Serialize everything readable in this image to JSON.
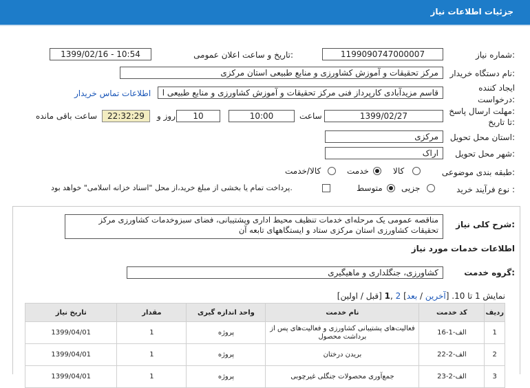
{
  "header": {
    "title": "جزئیات اطلاعات نیاز"
  },
  "form": {
    "need_number_label": "شماره نیاز:",
    "need_number": "1199090747000007",
    "announce_label": "تاریخ و ساعت اعلان عمومی:",
    "announce_value": "1399/02/16 - 10:54",
    "buyer_label": "نام دستگاه خریدار:",
    "buyer_value": "مرکز تحقیقات و آموزش کشاورزی و منابع طبیعی استان مرکزی",
    "requester_label_1": "ایجاد کننده",
    "requester_label_2": "درخواست:",
    "requester_value": "قاسم مزیدآبادی کارپرداز فنی مرکز تحقیقات و آموزش کشاورزی و منابع طبیعی ا",
    "contact_link": "اطلاعات تماس خریدار",
    "deadline_label_1": "مهلت ارسال پاسخ:",
    "deadline_label_2": "تا تاریخ:",
    "deadline_date": "1399/02/27",
    "time_label": "ساعت",
    "deadline_time": "10:00",
    "days_value": "10",
    "days_label": "روز و",
    "remaining_time": "22:32:29",
    "remaining_label": "ساعت باقی مانده",
    "province_label": "استان محل تحویل:",
    "province_value": "مرکزی",
    "city_label": "شهر محل تحویل:",
    "city_value": "اراک",
    "category_label": "طبقه بندی موضوعی:",
    "category_options": [
      "کالا",
      "خدمت",
      "کالا/خدمت"
    ],
    "process_label": "نوع فرآیند خرید :",
    "process_options": [
      "جزیی",
      "متوسط"
    ],
    "payment_note": "پرداخت تمام یا بخشی از مبلغ خرید،از محل \"اسناد خزانه اسلامی\" خواهد بود."
  },
  "description": {
    "label": "شرح کلی نیاز:",
    "line1": "مناقصه عمومی یک مرحله‌ای خدمات تنظیف محیط اداری وپشتیبانی، فضای سبزوخدمات کشاورزی مرکز",
    "line2": "تحقیقات کشاورزی استان مرکزی ستاد و ایستگاههای تابعه آن"
  },
  "services_info": {
    "title": "اطلاعات خدمات مورد نیاز",
    "group_label": "گروه خدمت:",
    "group_value": "کشاورزی، جنگلداری و ماهیگیری"
  },
  "pagination": {
    "text_before": "نمایش 1 تا 10. [",
    "last": "آخرین",
    "sep1": " / ",
    "next": "بعد",
    "mid": "] ",
    "page2": "2",
    "comma": " ,",
    "page1": "1",
    "text_after": " [قبل / اولین]"
  },
  "table": {
    "headers": [
      "ردیف",
      "کد خدمت",
      "نام خدمت",
      "واحد اندازه گیری",
      "مقدار",
      "تاریخ نیاز"
    ],
    "rows": [
      [
        "1",
        "الف-1-16",
        "فعالیت‌های پشتیبانی کشاورزی و فعالیت‌های پس از برداشت محصول",
        "پروژه",
        "1",
        "1399/04/01"
      ],
      [
        "2",
        "الف-2-22",
        "بریدن درختان",
        "پروژه",
        "1",
        "1399/04/01"
      ],
      [
        "3",
        "الف-2-23",
        "جمع‌آوری محصولات جنگلی غیرچوبی",
        "پروژه",
        "1",
        "1399/04/01"
      ]
    ]
  }
}
